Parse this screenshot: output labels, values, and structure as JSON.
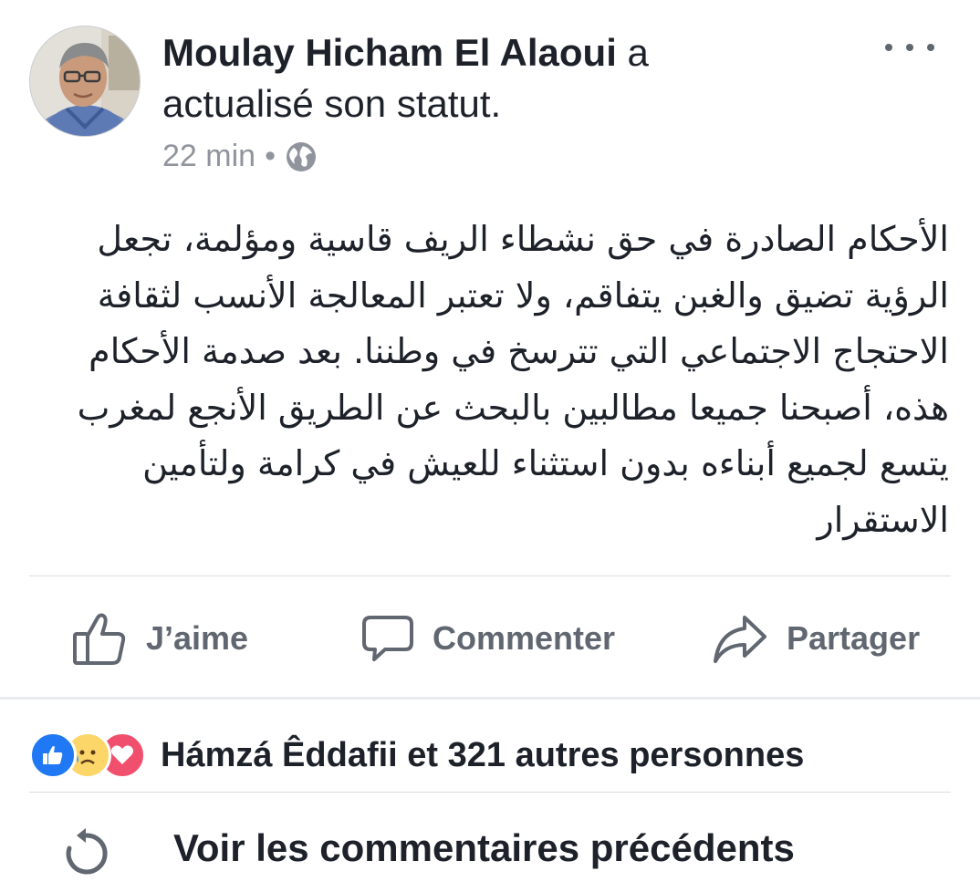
{
  "post": {
    "author": "Moulay Hicham El Alaoui",
    "action_word": " a",
    "action_line": "actualisé son statut.",
    "time": "22 min",
    "dot": "•",
    "body": "الأحكام الصادرة في حق نشطاء الريف قاسية ومؤلمة، تجعل الرؤية تضيق والغبن يتفاقم، ولا تعتبر المعالجة الأنسب لثقافة الاحتجاج الاجتماعي التي تترسخ في وطننا. بعد صدمة الأحكام هذه، أصبحنا جميعا مطالبين بالبحث عن الطريق الأنجع لمغرب يتسع لجميع أبناءه بدون استثناء للعيش في كرامة ولتأمين الاستقرار"
  },
  "icons": {
    "privacy": "globe-icon",
    "more": "more-options-icon",
    "like": "thumbs-up-icon",
    "comment": "speech-bubble-icon",
    "share": "share-arrow-icon",
    "refresh": "refresh-icon"
  },
  "actions": {
    "like_label": "J’aime",
    "comment_label": "Commenter",
    "share_label": "Partager"
  },
  "reactions": {
    "types": [
      "like",
      "sad",
      "love"
    ],
    "summary": "Hámzá Êddafii et 321 autres personnes"
  },
  "comments": {
    "previous_label": "Voir les commentaires précédents"
  },
  "colors": {
    "like_blue": "#2078f4",
    "love_red": "#f0506e",
    "sad_yellow": "#fcd669",
    "muted_text": "#90949c",
    "action_gray": "#606770"
  }
}
